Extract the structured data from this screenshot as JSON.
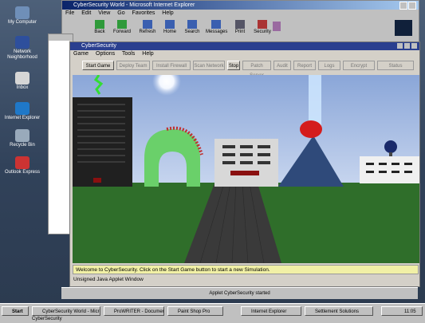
{
  "desktop": {
    "icons": [
      {
        "label": "My Computer",
        "color": "#6f8fb8"
      },
      {
        "label": "Network Neighborhood",
        "color": "#2e4f9c"
      },
      {
        "label": "Inbox",
        "color": "#d6d6d6"
      },
      {
        "label": "Internet Explorer",
        "color": "#1f78c8"
      },
      {
        "label": "Recycle Bin",
        "color": "#9ab"
      },
      {
        "label": "Outlook Express",
        "color": "#c33"
      }
    ]
  },
  "browser": {
    "title": "CyberSecurity World - Microsoft Internet Explorer",
    "menu": [
      "File",
      "Edit",
      "View",
      "Go",
      "Favorites",
      "Help"
    ],
    "toolbar": [
      "Back",
      "Forward",
      "Refresh",
      "Home",
      "Search",
      "Messages",
      "Print",
      "Security"
    ]
  },
  "app": {
    "title": "CyberSecurity",
    "menu": [
      "Game",
      "Options",
      "Tools",
      "Help"
    ],
    "buttons": [
      {
        "label": "Start Game",
        "enabled": true
      },
      {
        "label": "Deploy Team",
        "enabled": false
      },
      {
        "label": "Install Firewall",
        "enabled": false
      },
      {
        "label": "Scan Network",
        "enabled": false
      },
      {
        "label": "Stop",
        "enabled": true
      },
      {
        "label": "Patch Server",
        "enabled": false
      },
      {
        "label": "Audit",
        "enabled": false
      },
      {
        "label": "Report",
        "enabled": false
      },
      {
        "label": "Logs",
        "enabled": false
      },
      {
        "label": "Encrypt",
        "enabled": false
      },
      {
        "label": "Status",
        "enabled": false
      }
    ],
    "status_message": "Welcome to CyberSecurity. Click on the Start Game button to start a new Simulation.",
    "java_status": "Unsigned Java Applet Window",
    "lower_bar": "Applet CyberSecurity started"
  },
  "taskbar": {
    "start": "Start",
    "tasks": [
      "CyberSecurity World - Microsoft Inter...",
      "ProWRITER - Document1",
      "Paint Shop Pro",
      "Internet Explorer",
      "Settlement Solutions"
    ],
    "clock": "11:05",
    "below": "CyberSecurity"
  },
  "colors": {
    "sky": "#9fb8e0",
    "grass": "#2f6e2a",
    "road": "#3a3a3a",
    "status_yellow": "#f1f0a6"
  }
}
